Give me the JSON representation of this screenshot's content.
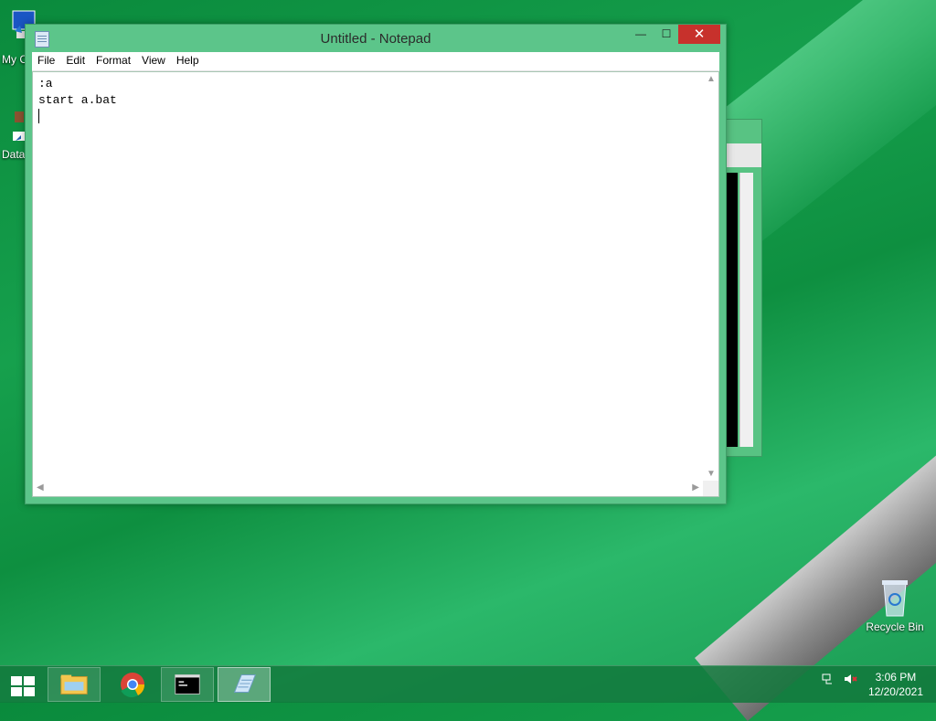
{
  "desktop": {
    "icons": [
      {
        "label": "My C"
      },
      {
        "label": "Data"
      },
      {
        "label": "Recycle Bin"
      }
    ]
  },
  "notepad": {
    "title": "Untitled - Notepad",
    "controls": {
      "minimize": "—",
      "maximize": "☐",
      "close": "✕"
    },
    "menu": [
      "File",
      "Edit",
      "Format",
      "View",
      "Help"
    ],
    "content": ":a\nstart a.bat\n"
  },
  "taskbar": {
    "apps": [
      {
        "name": "file-explorer"
      },
      {
        "name": "chrome"
      },
      {
        "name": "command-prompt"
      },
      {
        "name": "notepad",
        "active": true
      }
    ],
    "clock": {
      "time": "3:06 PM",
      "date": "12/20/2021"
    }
  }
}
